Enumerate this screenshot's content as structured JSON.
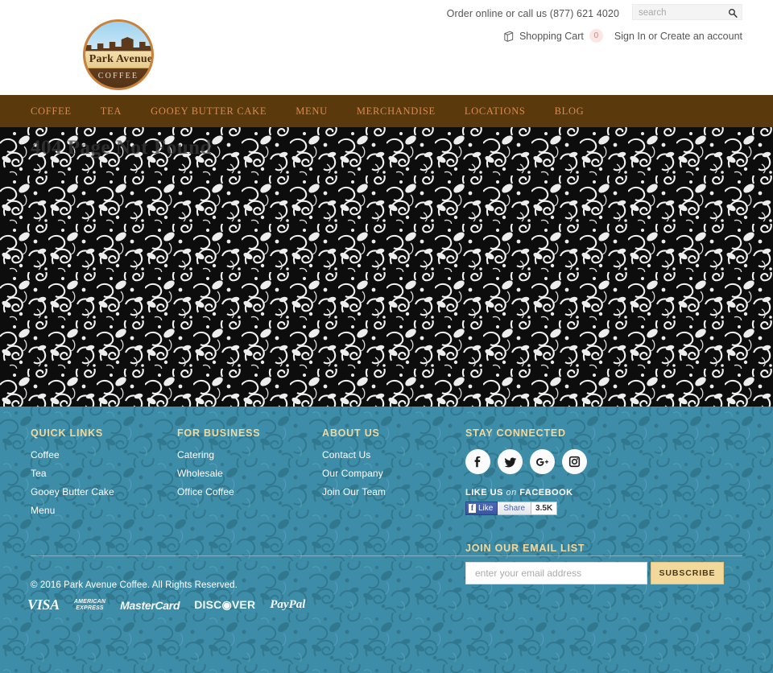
{
  "topbar": {
    "order_line": "Order online or call us (877) 621 4020",
    "search_placeholder": "search",
    "search_value": "",
    "search_icon": "search-icon",
    "cart_icon": "shopping-bag-icon",
    "cart_label": "Shopping Cart",
    "cart_count": "0",
    "account_links": "Sign In or Create an account"
  },
  "logo": {
    "name": "Park Avenue",
    "sub": "COFFEE"
  },
  "nav": {
    "items": [
      {
        "label": "COFFEE"
      },
      {
        "label": "TEA"
      },
      {
        "label": "GOOEY BUTTER CAKE"
      },
      {
        "label": "MENU"
      },
      {
        "label": "MERCHANDISE"
      },
      {
        "label": "LOCATIONS"
      },
      {
        "label": "BLOG"
      }
    ]
  },
  "main": {
    "page_title": "404 Page Not Found"
  },
  "footer": {
    "columns": [
      {
        "heading": "QUICK LINKS",
        "links": [
          "Coffee",
          "Tea",
          "Gooey Butter Cake",
          "Menu"
        ]
      },
      {
        "heading": "FOR BUSINESS",
        "links": [
          "Catering",
          "Wholesale",
          "Office Coffee"
        ]
      },
      {
        "heading": "ABOUT US",
        "links": [
          "Contact Us",
          "Our Company",
          "Join Our Team"
        ]
      }
    ],
    "stay_connected": {
      "heading": "STAY CONNECTED",
      "socials": [
        {
          "icon": "facebook-icon",
          "glyph": "f"
        },
        {
          "icon": "twitter-icon",
          "glyph": "t"
        },
        {
          "icon": "google-plus-icon",
          "glyph": "g+"
        },
        {
          "icon": "instagram-icon",
          "glyph": "ig"
        }
      ]
    },
    "facebook": {
      "label_a": "LIKE US",
      "label_b": "on",
      "label_c": "FACEBOOK",
      "like_text": "Like",
      "share_text": "Share",
      "count": "3.5K"
    },
    "email": {
      "heading": "JOIN OUR EMAIL LIST",
      "placeholder": "enter your email address",
      "value": "",
      "button": "SUBSCRIBE"
    },
    "copyright": "© 2016 Park Avenue Coffee. All Rights Reserved.",
    "payments": [
      {
        "name": "visa",
        "label": "VISA"
      },
      {
        "name": "american-express",
        "label_1": "AMERICAN",
        "label_2": "EXPRESS"
      },
      {
        "name": "mastercard",
        "label_a": "Master",
        "label_b": "Card"
      },
      {
        "name": "discover",
        "label_a": "DISC",
        "label_b": "VER"
      },
      {
        "name": "paypal",
        "label_a": "Pay",
        "label_b": "Pal"
      }
    ]
  },
  "colors": {
    "brand_brown": "#5a3a0c",
    "nav_link": "#d98a50",
    "footer_blue": "#3d8ca8",
    "accent_tan": "#f3d89b"
  }
}
